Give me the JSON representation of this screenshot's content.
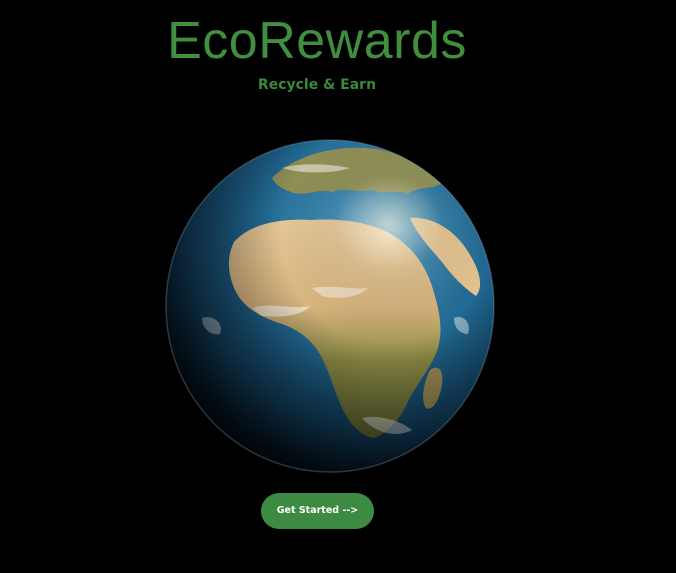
{
  "header": {
    "title": "EcoRewards",
    "subtitle": "Recycle & Earn"
  },
  "hero": {
    "image": "earth-globe"
  },
  "actions": {
    "get_started_label": "Get Started -->"
  },
  "colors": {
    "background": "#000000",
    "brand_green": "#3f8f3f",
    "button_green": "#3d8a42",
    "button_text": "#ffffff",
    "ocean": "#1f5f86",
    "land_desert": "#d8b884",
    "land_green": "#6b7a3a"
  }
}
